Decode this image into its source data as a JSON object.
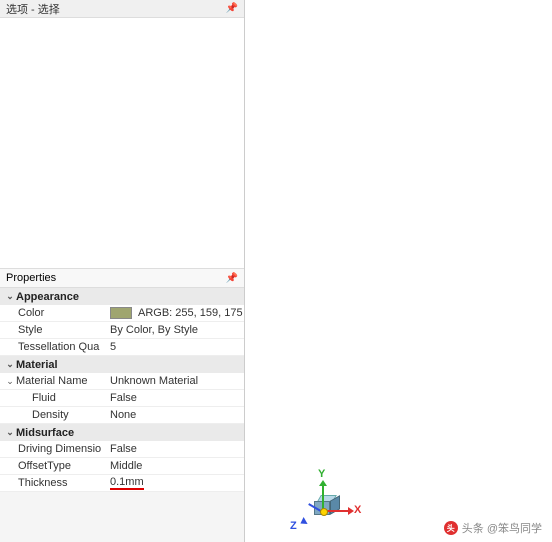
{
  "top_section": {
    "title": "选项 - 选择"
  },
  "properties_title": "Properties",
  "groups": {
    "appearance": {
      "title": "Appearance",
      "color_label": "Color",
      "color_value": "ARGB: 255, 159, 175",
      "color_swatch": "#9fa56f",
      "style_label": "Style",
      "style_value": "By Color, By Style",
      "tess_label": "Tessellation Qua",
      "tess_value": "5"
    },
    "material": {
      "title": "Material",
      "name_label": "Material Name",
      "name_value": "Unknown Material",
      "fluid_label": "Fluid",
      "fluid_value": "False",
      "density_label": "Density",
      "density_value": "None"
    },
    "midsurface": {
      "title": "Midsurface",
      "driving_label": "Driving Dimensio",
      "driving_value": "False",
      "offset_label": "OffsetType",
      "offset_value": "Middle",
      "thickness_label": "Thickness",
      "thickness_value": "0.1mm"
    }
  },
  "axes": {
    "x": "X",
    "y": "Y",
    "z": "Z"
  },
  "watermark": "头条 @笨鸟同学"
}
